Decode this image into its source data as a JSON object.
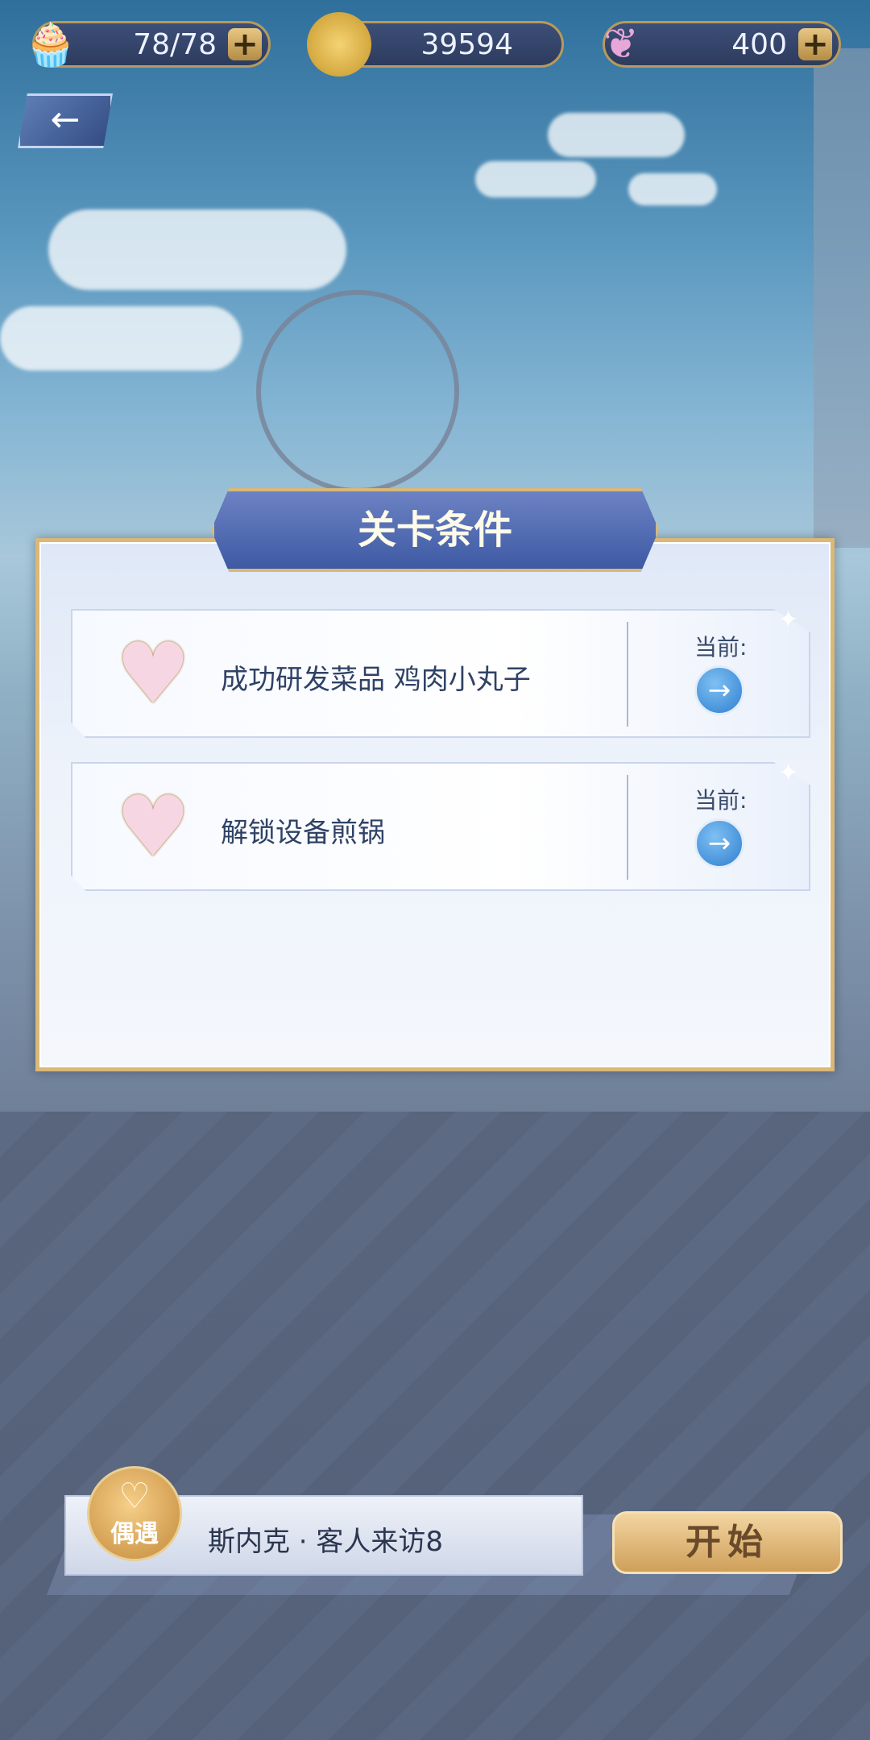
{
  "resources": {
    "stamina": {
      "value": "78/78",
      "plus": "+",
      "icon": "cupcake-icon"
    },
    "coins": {
      "value": "39594",
      "icon": "gold-coin-icon"
    },
    "gems": {
      "value": "400",
      "plus": "+",
      "icon": "crystal-swan-icon"
    }
  },
  "back": {
    "arrow": "←",
    "icon": "back-arrow-icon"
  },
  "dialog": {
    "title": "关卡条件",
    "conditions": [
      {
        "text": "成功研发菜品 鸡肉小丸子",
        "current_label": "当前:",
        "go": "→"
      },
      {
        "text": "解锁设备煎锅",
        "current_label": "当前:",
        "go": "→"
      }
    ]
  },
  "bottom": {
    "encounter_tag": "偶遇",
    "level_name": "斯内克 · 客人来访8",
    "start": "开始"
  },
  "colors": {
    "accent_gold": "#d9b878",
    "title_blue": "#3e5aa4",
    "go_blue": "#2f7fcf"
  }
}
